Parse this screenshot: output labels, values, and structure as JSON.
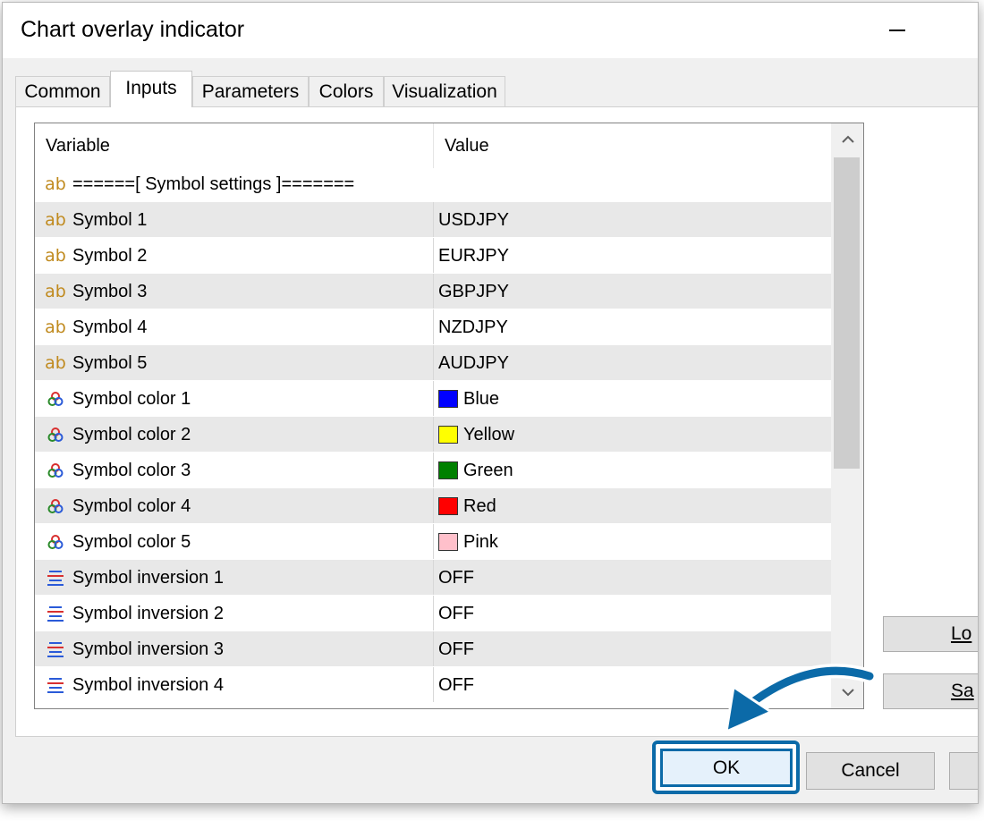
{
  "window": {
    "title": "Chart overlay indicator"
  },
  "tabs": [
    {
      "label": "Common",
      "active": false
    },
    {
      "label": "Inputs",
      "active": true
    },
    {
      "label": "Parameters",
      "active": false
    },
    {
      "label": "Colors",
      "active": false
    },
    {
      "label": "Visualization",
      "active": false
    }
  ],
  "table": {
    "columns": [
      "Variable",
      "Value"
    ],
    "rows": [
      {
        "icon": "ab-string-icon",
        "variable": "======[ Symbol settings ]=======",
        "value": ""
      },
      {
        "icon": "ab-string-icon",
        "variable": "Symbol 1",
        "value": "USDJPY"
      },
      {
        "icon": "ab-string-icon",
        "variable": "Symbol 2",
        "value": "EURJPY"
      },
      {
        "icon": "ab-string-icon",
        "variable": "Symbol 3",
        "value": "GBPJPY"
      },
      {
        "icon": "ab-string-icon",
        "variable": "Symbol 4",
        "value": "NZDJPY"
      },
      {
        "icon": "ab-string-icon",
        "variable": "Symbol 5",
        "value": "AUDJPY"
      },
      {
        "icon": "color-circles-icon",
        "variable": "Symbol color 1",
        "value": "Blue",
        "swatch": "#0000ff"
      },
      {
        "icon": "color-circles-icon",
        "variable": "Symbol color 2",
        "value": "Yellow",
        "swatch": "#ffff00"
      },
      {
        "icon": "color-circles-icon",
        "variable": "Symbol color 3",
        "value": "Green",
        "swatch": "#008000"
      },
      {
        "icon": "color-circles-icon",
        "variable": "Symbol color 4",
        "value": "Red",
        "swatch": "#ff0000"
      },
      {
        "icon": "color-circles-icon",
        "variable": "Symbol color 5",
        "value": "Pink",
        "swatch": "#ffc0cb"
      },
      {
        "icon": "enum-list-icon",
        "variable": "Symbol inversion 1",
        "value": "OFF"
      },
      {
        "icon": "enum-list-icon",
        "variable": "Symbol inversion 2",
        "value": "OFF"
      },
      {
        "icon": "enum-list-icon",
        "variable": "Symbol inversion 3",
        "value": "OFF"
      },
      {
        "icon": "enum-list-icon",
        "variable": "Symbol inversion 4",
        "value": "OFF"
      }
    ]
  },
  "side_buttons": {
    "load": "Lo",
    "save": "Sa"
  },
  "buttons": {
    "ok": "OK",
    "cancel": "Cancel"
  },
  "colors": {
    "highlight": "#0b6aa8",
    "ab_icon": "#c08a1e"
  }
}
